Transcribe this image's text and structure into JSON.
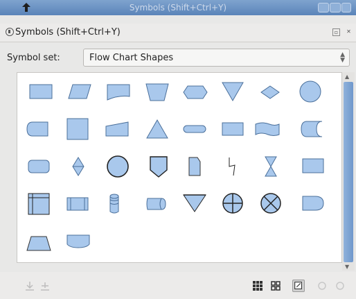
{
  "window": {
    "title": "Symbols (Shift+Ctrl+Y)"
  },
  "panel": {
    "title": "Symbols (Shift+Ctrl+Y)"
  },
  "symbol_set": {
    "label": "Symbol set:",
    "value": "Flow Chart Shapes"
  },
  "colors": {
    "shape_fill": "#a9c8ec",
    "shape_stroke": "#4a6f9a",
    "title_bar": "#6a90c2"
  },
  "symbols": [
    "process",
    "data",
    "document",
    "manual-operation",
    "display",
    "extract",
    "sort",
    "connector",
    "stored-data",
    "process-square",
    "manual-input",
    "merge",
    "terminator",
    "card",
    "punched-tape",
    "direct-access",
    "rounded-process",
    "decision",
    "circle",
    "off-page-connector",
    "card-edge",
    "lightning",
    "collate",
    "rectangle",
    "internal-storage",
    "predefined-process",
    "magnetic-disk",
    "drum",
    "merge-triangle",
    "summing-junction",
    "or",
    "delay",
    "manual-loop",
    "tape-document"
  ],
  "scrollbar": {
    "position": 0.0
  },
  "view_buttons": [
    "small-grid-icon",
    "large-grid-icon",
    "fit-icon",
    "zoom-in-icon",
    "zoom-out-icon"
  ]
}
